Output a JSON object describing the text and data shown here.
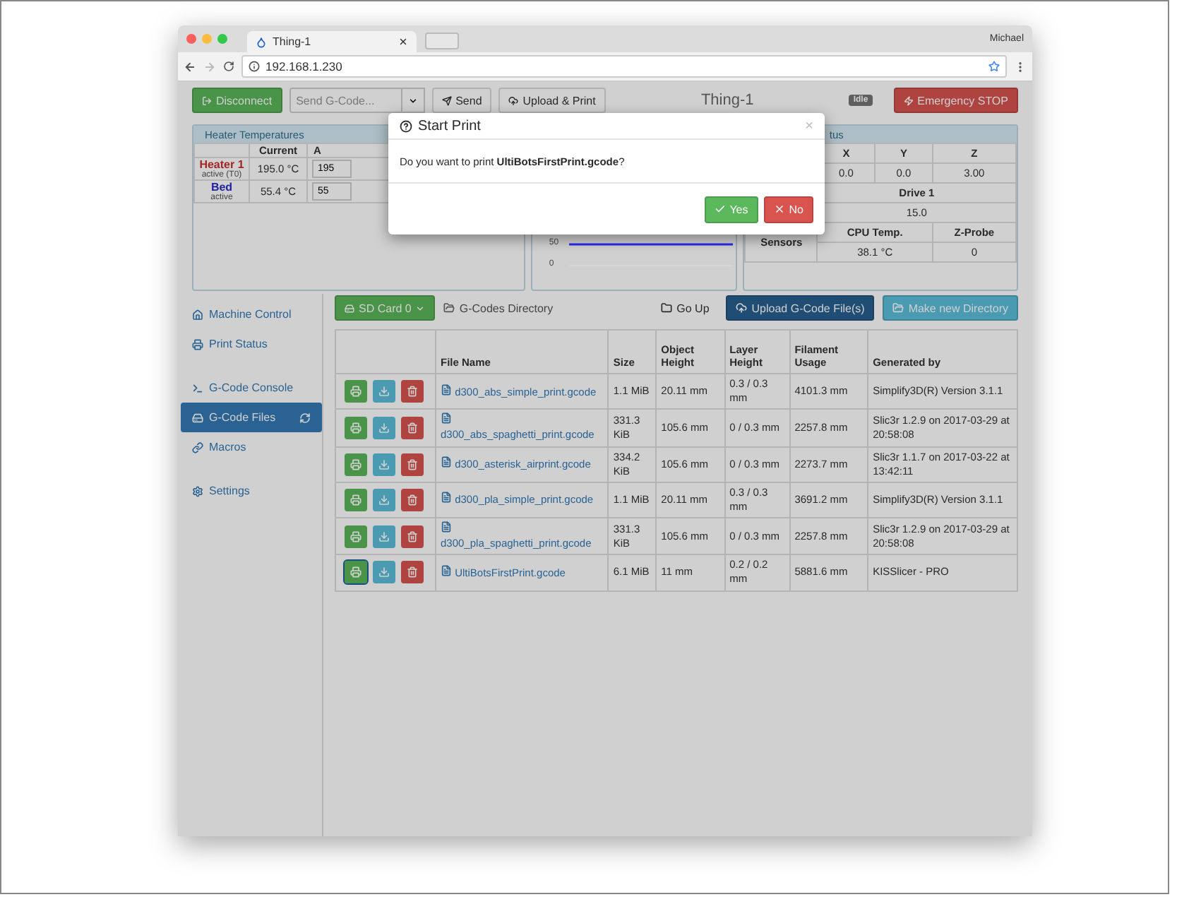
{
  "browser": {
    "tab_title": "Thing-1",
    "profile": "Michael",
    "url": "192.168.1.230"
  },
  "toolbar": {
    "disconnect": "Disconnect",
    "gcode_placeholder": "Send G-Code...",
    "send": "Send",
    "upload_print": "Upload & Print",
    "title": "Thing-1",
    "status": "Idle",
    "emergency": "Emergency STOP"
  },
  "heaters": {
    "title": "Heater Temperatures",
    "columns": [
      "Current",
      "A"
    ],
    "rows": [
      {
        "name": "Heater 1",
        "status": "active (T0)",
        "current": "195.0 °C",
        "active_value": "195",
        "color": "#a32624"
      },
      {
        "name": "Bed",
        "status": "active",
        "current": "55.4 °C",
        "active_value": "55",
        "color": "#2222a3"
      }
    ]
  },
  "chart": {
    "ticks": [
      "50",
      "0"
    ]
  },
  "machine": {
    "title": "tus",
    "axes": [
      {
        "label": "X",
        "value": "0.0"
      },
      {
        "label": "Y",
        "value": "0.0"
      },
      {
        "label": "Z",
        "value": "3.00"
      }
    ],
    "drive": {
      "label": "Drive 1",
      "value": "15.0"
    },
    "sensors": {
      "label": "Sensors",
      "columns": [
        {
          "label": "CPU Temp.",
          "value": "38.1 °C"
        },
        {
          "label": "Z-Probe",
          "value": "0"
        }
      ]
    }
  },
  "sidebar": {
    "groups": [
      [
        {
          "label": "Machine Control",
          "selected": false
        },
        {
          "label": "Print Status",
          "selected": false
        }
      ],
      [
        {
          "label": "G-Code Console",
          "selected": false
        },
        {
          "label": "G-Code Files",
          "selected": true
        },
        {
          "label": "Macros",
          "selected": false
        }
      ],
      [
        {
          "label": "Settings",
          "selected": false
        }
      ]
    ]
  },
  "files": {
    "sd_card": "SD Card 0",
    "directory": "G-Codes Directory",
    "go_up": "Go Up",
    "upload": "Upload G-Code File(s)",
    "mkdir": "Make new Directory",
    "columns": [
      "File Name",
      "Size",
      "Object Height",
      "Layer Height",
      "Filament Usage",
      "Generated by"
    ],
    "rows": [
      {
        "name": "d300_abs_simple_print.gcode",
        "size": "1.1 MiB",
        "object_height": "20.11 mm",
        "layer_height": "0.3 / 0.3 mm",
        "filament": "4101.3 mm",
        "generator": "Simplify3D(R) Version 3.1.1",
        "focused": false
      },
      {
        "name": "d300_abs_spaghetti_print.gcode",
        "size": "331.3 KiB",
        "object_height": "105.6 mm",
        "layer_height": "0 / 0.3 mm",
        "filament": "2257.8 mm",
        "generator": "Slic3r 1.2.9 on 2017-03-29 at 20:58:08",
        "focused": false
      },
      {
        "name": "d300_asterisk_airprint.gcode",
        "size": "334.2 KiB",
        "object_height": "105.6 mm",
        "layer_height": "0 / 0.3 mm",
        "filament": "2273.7 mm",
        "generator": "Slic3r 1.1.7 on 2017-03-22 at 13:42:11",
        "focused": false
      },
      {
        "name": "d300_pla_simple_print.gcode",
        "size": "1.1 MiB",
        "object_height": "20.11 mm",
        "layer_height": "0.3 / 0.3 mm",
        "filament": "3691.2 mm",
        "generator": "Simplify3D(R) Version 3.1.1",
        "focused": false
      },
      {
        "name": "d300_pla_spaghetti_print.gcode",
        "size": "331.3 KiB",
        "object_height": "105.6 mm",
        "layer_height": "0 / 0.3 mm",
        "filament": "2257.8 mm",
        "generator": "Slic3r 1.2.9 on 2017-03-29 at 20:58:08",
        "focused": false
      },
      {
        "name": "UltiBotsFirstPrint.gcode",
        "size": "6.1 MiB",
        "object_height": "11 mm",
        "layer_height": "0.2 / 0.2 mm",
        "filament": "5881.6 mm",
        "generator": "KISSlicer - PRO",
        "focused": true
      }
    ]
  },
  "modal": {
    "title": "Start Print",
    "close": "×",
    "message": "Do you want to print **UltiBotsFirstPrint.gcode**?",
    "yes": "Yes",
    "no": "No"
  }
}
